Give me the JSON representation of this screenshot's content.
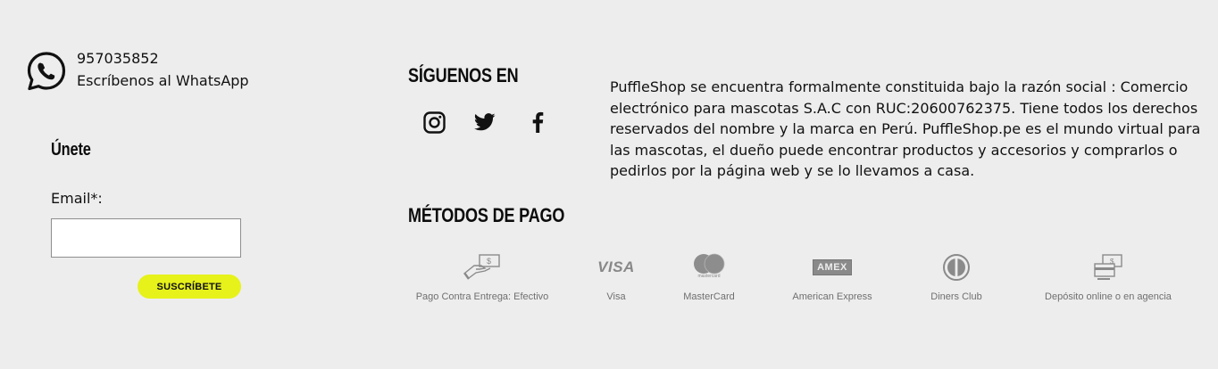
{
  "contact": {
    "phone": "957035852",
    "whatsapp_text": "Escríbenos al WhatsApp"
  },
  "newsletter": {
    "title": "Únete",
    "email_label": "Email*:",
    "email_value": "",
    "subscribe_label": "SUSCRÍBETE"
  },
  "social": {
    "title": "SÍGUENOS EN",
    "items": [
      {
        "icon": "instagram-icon"
      },
      {
        "icon": "twitter-icon"
      },
      {
        "icon": "facebook-icon"
      }
    ]
  },
  "payment": {
    "title": "MÉTODOS DE PAGO",
    "methods": [
      {
        "label": "Pago Contra Entrega: Efectivo",
        "icon": "cash-on-delivery-icon"
      },
      {
        "label": "Visa",
        "icon": "visa-icon"
      },
      {
        "label": "MasterCard",
        "icon": "mastercard-icon"
      },
      {
        "label": "American Express",
        "icon": "amex-icon"
      },
      {
        "label": "Diners Club",
        "icon": "diners-club-icon"
      },
      {
        "label": "Depósito online o en agencia",
        "icon": "bank-deposit-icon"
      }
    ],
    "card_marks": {
      "visa": "VISA",
      "mastercard": "mastercard",
      "amex": "AMEX"
    }
  },
  "about": {
    "text": "PuffleShop se encuentra formalmente constituida bajo la razón social : Comercio electrónico para mascotas S.A.C con RUC:20600762375. Tiene todos los derechos reservados del nombre y la marca en Perú. PuffleShop.pe es el mundo virtual para las mascotas, el dueño puede encontrar productos y accesorios y comprarlos o pedirlos por la página web y se lo llevamos a casa."
  },
  "colors": {
    "background": "#eeeded",
    "accent": "#e6f21a",
    "icon_gray": "#8a8a8a"
  }
}
